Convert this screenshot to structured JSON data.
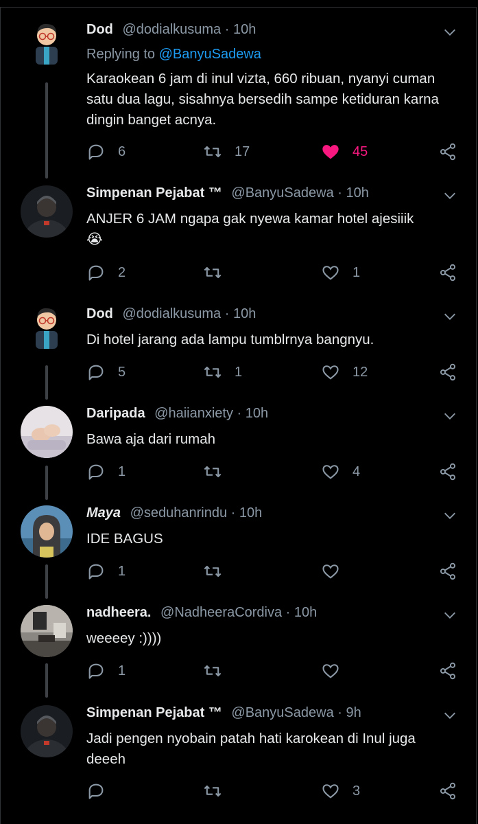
{
  "tweets": [
    {
      "name": "Dod",
      "handle": "@dodialkusuma",
      "time": "10h",
      "replying_label": "Replying to",
      "replying_to": "@BanyuSadewa",
      "text": "Karaokean 6 jam di inul vizta, 660 ribuan, nyanyi cuman satu dua lagu, sisahnya bersedih sampe ketiduran karna dingin banget acnya.",
      "replies": "6",
      "retweets": "17",
      "likes": "45",
      "liked": true,
      "avatar": "cartoon-man-glasses"
    },
    {
      "name": "Simpenan Pejabat ™",
      "handle": "@BanyuSadewa",
      "time": "10h",
      "text": "ANJER 6 JAM ngapa gak nyewa kamar hotel ajesiiik",
      "emoji": "😭",
      "replies": "2",
      "retweets": "",
      "likes": "1",
      "avatar": "dark-photo-hooded-person"
    },
    {
      "name": "Dod",
      "handle": "@dodialkusuma",
      "time": "10h",
      "text": "Di hotel jarang ada lampu tumblrnya bangnyu.",
      "replies": "5",
      "retweets": "1",
      "likes": "12",
      "avatar": "cartoon-man-glasses"
    },
    {
      "name": "Daripada",
      "handle": "@haiianxiety",
      "time": "10h",
      "text": "Bawa aja dari rumah",
      "replies": "1",
      "retweets": "",
      "likes": "4",
      "avatar": "photo-hands"
    },
    {
      "name": "Maya",
      "handle": "@seduhanrindu",
      "time": "10h",
      "text": "IDE BAGUS",
      "replies": "1",
      "retweets": "",
      "likes": "",
      "avatar": "photo-hijab-woman"
    },
    {
      "name": "nadheera.",
      "handle": "@NadheeraCordiva",
      "time": "10h",
      "text": "weeeey :))))",
      "replies": "1",
      "retweets": "",
      "likes": "",
      "avatar": "photo-room"
    },
    {
      "name": "Simpenan Pejabat ™",
      "handle": "@BanyuSadewa",
      "time": "9h",
      "text": "Jadi pengen nyobain patah hati karokean di Inul juga deeeh",
      "replies": "",
      "retweets": "",
      "likes": "3",
      "avatar": "dark-photo-hooded-person"
    }
  ],
  "colors": {
    "accent": "#1d9bf0",
    "like": "#f91880",
    "muted": "#8b98a5",
    "background": "#000000"
  },
  "icons": [
    "reply-icon",
    "retweet-icon",
    "like-icon",
    "share-icon",
    "chevron-down-icon"
  ]
}
